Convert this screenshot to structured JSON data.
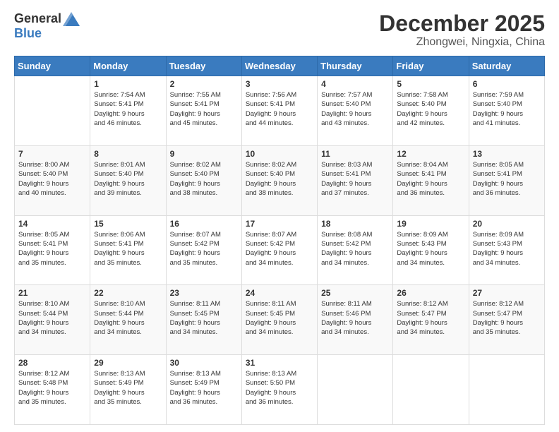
{
  "logo": {
    "general": "General",
    "blue": "Blue"
  },
  "title": "December 2025",
  "subtitle": "Zhongwei, Ningxia, China",
  "weekdays": [
    "Sunday",
    "Monday",
    "Tuesday",
    "Wednesday",
    "Thursday",
    "Friday",
    "Saturday"
  ],
  "weeks": [
    [
      {
        "day": "",
        "info": ""
      },
      {
        "day": "1",
        "info": "Sunrise: 7:54 AM\nSunset: 5:41 PM\nDaylight: 9 hours\nand 46 minutes."
      },
      {
        "day": "2",
        "info": "Sunrise: 7:55 AM\nSunset: 5:41 PM\nDaylight: 9 hours\nand 45 minutes."
      },
      {
        "day": "3",
        "info": "Sunrise: 7:56 AM\nSunset: 5:41 PM\nDaylight: 9 hours\nand 44 minutes."
      },
      {
        "day": "4",
        "info": "Sunrise: 7:57 AM\nSunset: 5:40 PM\nDaylight: 9 hours\nand 43 minutes."
      },
      {
        "day": "5",
        "info": "Sunrise: 7:58 AM\nSunset: 5:40 PM\nDaylight: 9 hours\nand 42 minutes."
      },
      {
        "day": "6",
        "info": "Sunrise: 7:59 AM\nSunset: 5:40 PM\nDaylight: 9 hours\nand 41 minutes."
      }
    ],
    [
      {
        "day": "7",
        "info": "Sunrise: 8:00 AM\nSunset: 5:40 PM\nDaylight: 9 hours\nand 40 minutes."
      },
      {
        "day": "8",
        "info": "Sunrise: 8:01 AM\nSunset: 5:40 PM\nDaylight: 9 hours\nand 39 minutes."
      },
      {
        "day": "9",
        "info": "Sunrise: 8:02 AM\nSunset: 5:40 PM\nDaylight: 9 hours\nand 38 minutes."
      },
      {
        "day": "10",
        "info": "Sunrise: 8:02 AM\nSunset: 5:40 PM\nDaylight: 9 hours\nand 38 minutes."
      },
      {
        "day": "11",
        "info": "Sunrise: 8:03 AM\nSunset: 5:41 PM\nDaylight: 9 hours\nand 37 minutes."
      },
      {
        "day": "12",
        "info": "Sunrise: 8:04 AM\nSunset: 5:41 PM\nDaylight: 9 hours\nand 36 minutes."
      },
      {
        "day": "13",
        "info": "Sunrise: 8:05 AM\nSunset: 5:41 PM\nDaylight: 9 hours\nand 36 minutes."
      }
    ],
    [
      {
        "day": "14",
        "info": "Sunrise: 8:05 AM\nSunset: 5:41 PM\nDaylight: 9 hours\nand 35 minutes."
      },
      {
        "day": "15",
        "info": "Sunrise: 8:06 AM\nSunset: 5:41 PM\nDaylight: 9 hours\nand 35 minutes."
      },
      {
        "day": "16",
        "info": "Sunrise: 8:07 AM\nSunset: 5:42 PM\nDaylight: 9 hours\nand 35 minutes."
      },
      {
        "day": "17",
        "info": "Sunrise: 8:07 AM\nSunset: 5:42 PM\nDaylight: 9 hours\nand 34 minutes."
      },
      {
        "day": "18",
        "info": "Sunrise: 8:08 AM\nSunset: 5:42 PM\nDaylight: 9 hours\nand 34 minutes."
      },
      {
        "day": "19",
        "info": "Sunrise: 8:09 AM\nSunset: 5:43 PM\nDaylight: 9 hours\nand 34 minutes."
      },
      {
        "day": "20",
        "info": "Sunrise: 8:09 AM\nSunset: 5:43 PM\nDaylight: 9 hours\nand 34 minutes."
      }
    ],
    [
      {
        "day": "21",
        "info": "Sunrise: 8:10 AM\nSunset: 5:44 PM\nDaylight: 9 hours\nand 34 minutes."
      },
      {
        "day": "22",
        "info": "Sunrise: 8:10 AM\nSunset: 5:44 PM\nDaylight: 9 hours\nand 34 minutes."
      },
      {
        "day": "23",
        "info": "Sunrise: 8:11 AM\nSunset: 5:45 PM\nDaylight: 9 hours\nand 34 minutes."
      },
      {
        "day": "24",
        "info": "Sunrise: 8:11 AM\nSunset: 5:45 PM\nDaylight: 9 hours\nand 34 minutes."
      },
      {
        "day": "25",
        "info": "Sunrise: 8:11 AM\nSunset: 5:46 PM\nDaylight: 9 hours\nand 34 minutes."
      },
      {
        "day": "26",
        "info": "Sunrise: 8:12 AM\nSunset: 5:47 PM\nDaylight: 9 hours\nand 34 minutes."
      },
      {
        "day": "27",
        "info": "Sunrise: 8:12 AM\nSunset: 5:47 PM\nDaylight: 9 hours\nand 35 minutes."
      }
    ],
    [
      {
        "day": "28",
        "info": "Sunrise: 8:12 AM\nSunset: 5:48 PM\nDaylight: 9 hours\nand 35 minutes."
      },
      {
        "day": "29",
        "info": "Sunrise: 8:13 AM\nSunset: 5:49 PM\nDaylight: 9 hours\nand 35 minutes."
      },
      {
        "day": "30",
        "info": "Sunrise: 8:13 AM\nSunset: 5:49 PM\nDaylight: 9 hours\nand 36 minutes."
      },
      {
        "day": "31",
        "info": "Sunrise: 8:13 AM\nSunset: 5:50 PM\nDaylight: 9 hours\nand 36 minutes."
      },
      {
        "day": "",
        "info": ""
      },
      {
        "day": "",
        "info": ""
      },
      {
        "day": "",
        "info": ""
      }
    ]
  ]
}
